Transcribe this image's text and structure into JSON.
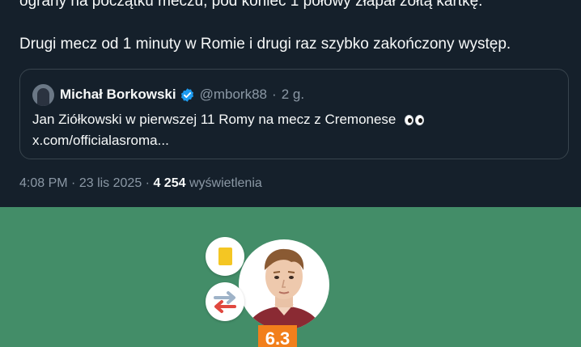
{
  "tweet": {
    "text_line1": "ograny na początku meczu, pod koniec 1 połowy złapał żółtą kartkę.",
    "text_line2": "Drugi mecz od 1 minuty w Romie i drugi raz szybko zakończony występ.",
    "quote": {
      "author_name": "Michał Borkowski",
      "handle": "@mbork88",
      "separator": "·",
      "time_ago": "2 g.",
      "text_line1": "Jan Ziółkowski w pierwszej 11 Romy na mecz z Cremonese",
      "text_line2": "x.com/officialasroma..."
    },
    "meta": {
      "time": "4:08 PM",
      "date": "23 lis 2025",
      "views_count": "4 254",
      "views_label": "wyświetlenia"
    }
  },
  "player_card": {
    "rating": "6.3",
    "yellow_card_color": "#f4c623",
    "rating_color": "#f27f1b",
    "pitch_color": "#438d68"
  },
  "colors": {
    "background": "#15202b",
    "text": "#f7f9f9",
    "secondary_text": "#8b98a5",
    "border": "#38444d",
    "verified": "#1d9bf0"
  }
}
